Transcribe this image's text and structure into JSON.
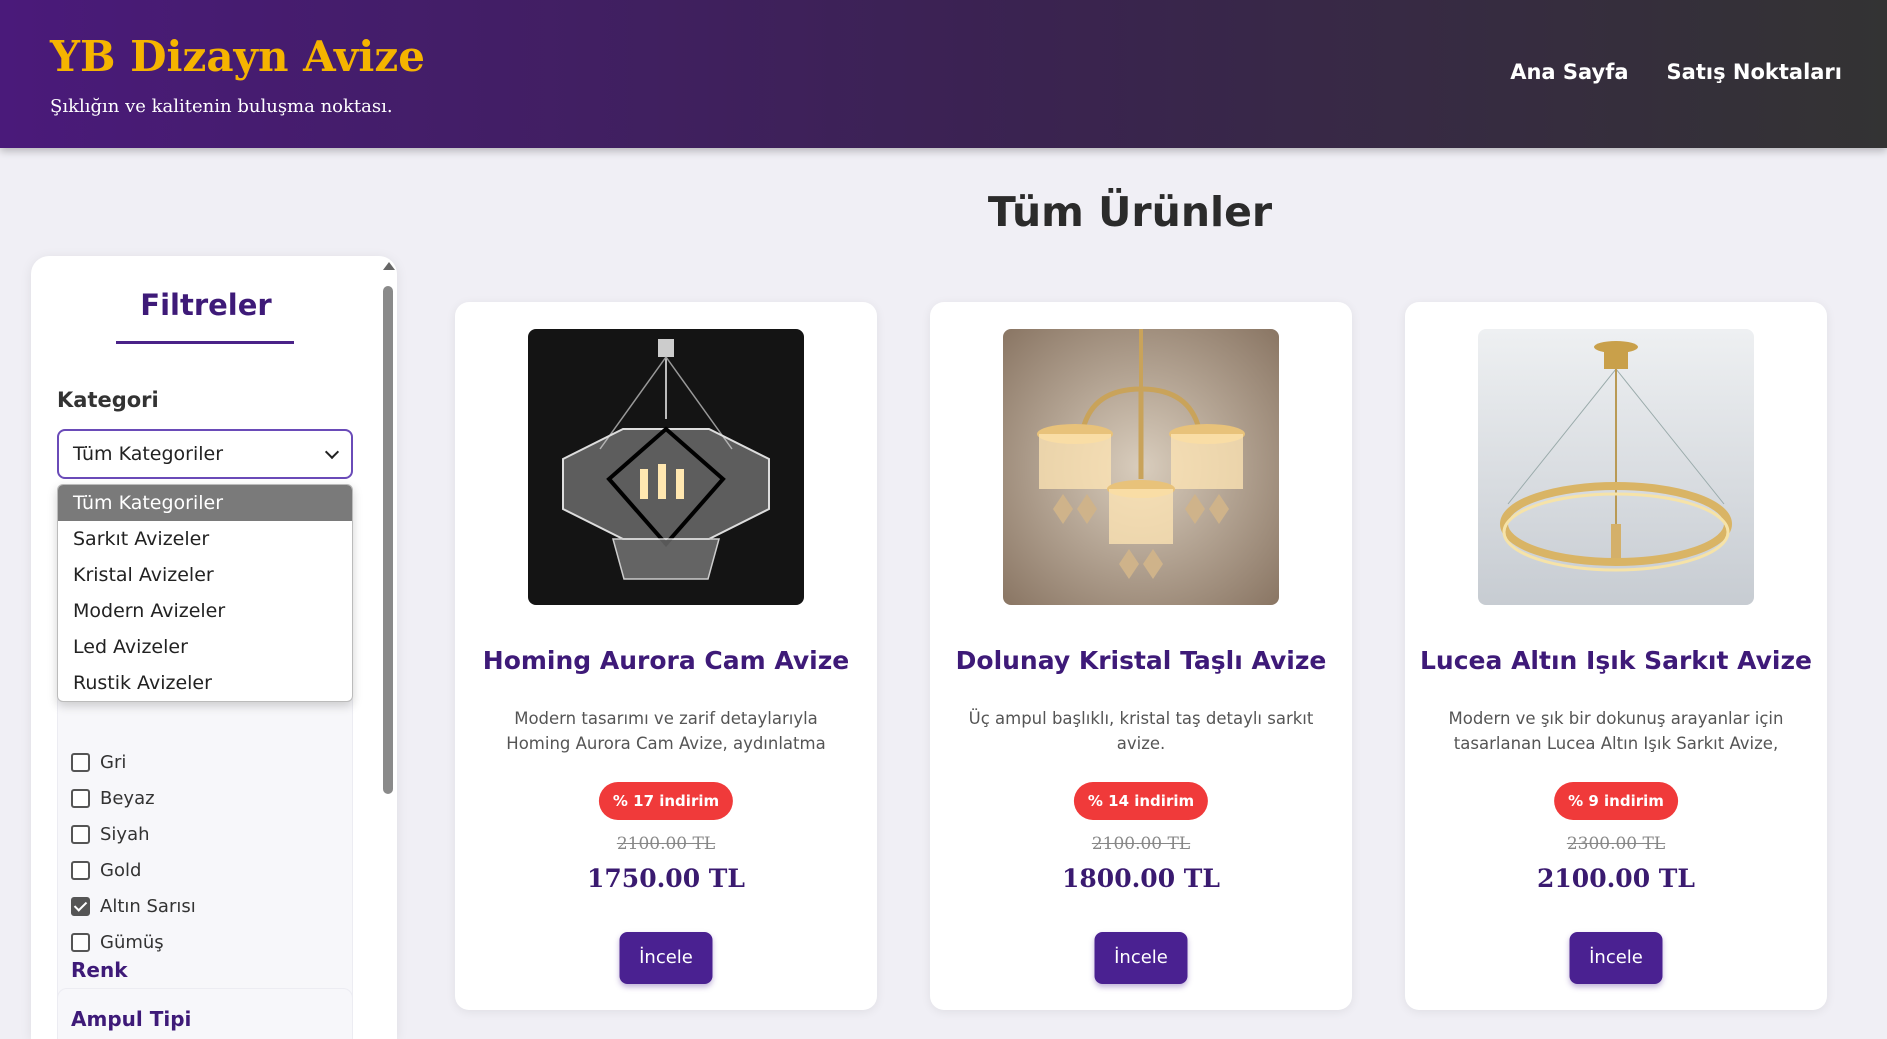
{
  "header": {
    "brand": "YB Dizayn Avize",
    "tagline": "Şıklığın ve kalitenin buluşma noktası.",
    "nav": [
      "Ana Sayfa",
      "Satış Noktaları"
    ]
  },
  "page_title": "Tüm Ürünler",
  "sidebar": {
    "title": "Filtreler",
    "category_label": "Kategori",
    "category_selected": "Tüm Kategoriler",
    "category_options": [
      "Tüm Kategoriler",
      "Sarkıt Avizeler",
      "Kristal Avizeler",
      "Modern Avizeler",
      "Led Avizeler",
      "Rustik Avizeler"
    ],
    "color_label": "Renk",
    "colors": [
      {
        "label": "Gri",
        "checked": false
      },
      {
        "label": "Beyaz",
        "checked": false
      },
      {
        "label": "Siyah",
        "checked": false
      },
      {
        "label": "Gold",
        "checked": false
      },
      {
        "label": "Altın Sarısı",
        "checked": true
      },
      {
        "label": "Gümüş",
        "checked": false
      }
    ],
    "bulb_label": "Ampul Tipi"
  },
  "products": [
    {
      "name": "Homing Aurora Cam Avize",
      "description": "Modern tasarımı ve zarif detaylarıyla Homing Aurora Cam Avize, aydınlatma ihtiyaçlarınızı şık",
      "discount": "% 17 indirim",
      "old_price": "2100.00 TL",
      "price": "1750.00 TL",
      "button": "İncele"
    },
    {
      "name": "Dolunay Kristal Taşlı Avize",
      "description": "Üç ampul başlıklı, kristal taş detaylı sarkıt avize.",
      "discount": "% 14 indirim",
      "old_price": "2100.00 TL",
      "price": "1800.00 TL",
      "button": "İncele"
    },
    {
      "name": "Lucea Altın Işık Sarkıt Avize",
      "description": "Modern ve şık bir dokunuş arayanlar için tasarlanan Lucea Altın Işık Sarkıt Avize, minimalist",
      "discount": "% 9 indirim",
      "old_price": "2300.00 TL",
      "price": "2100.00 TL",
      "button": "İncele"
    }
  ]
}
